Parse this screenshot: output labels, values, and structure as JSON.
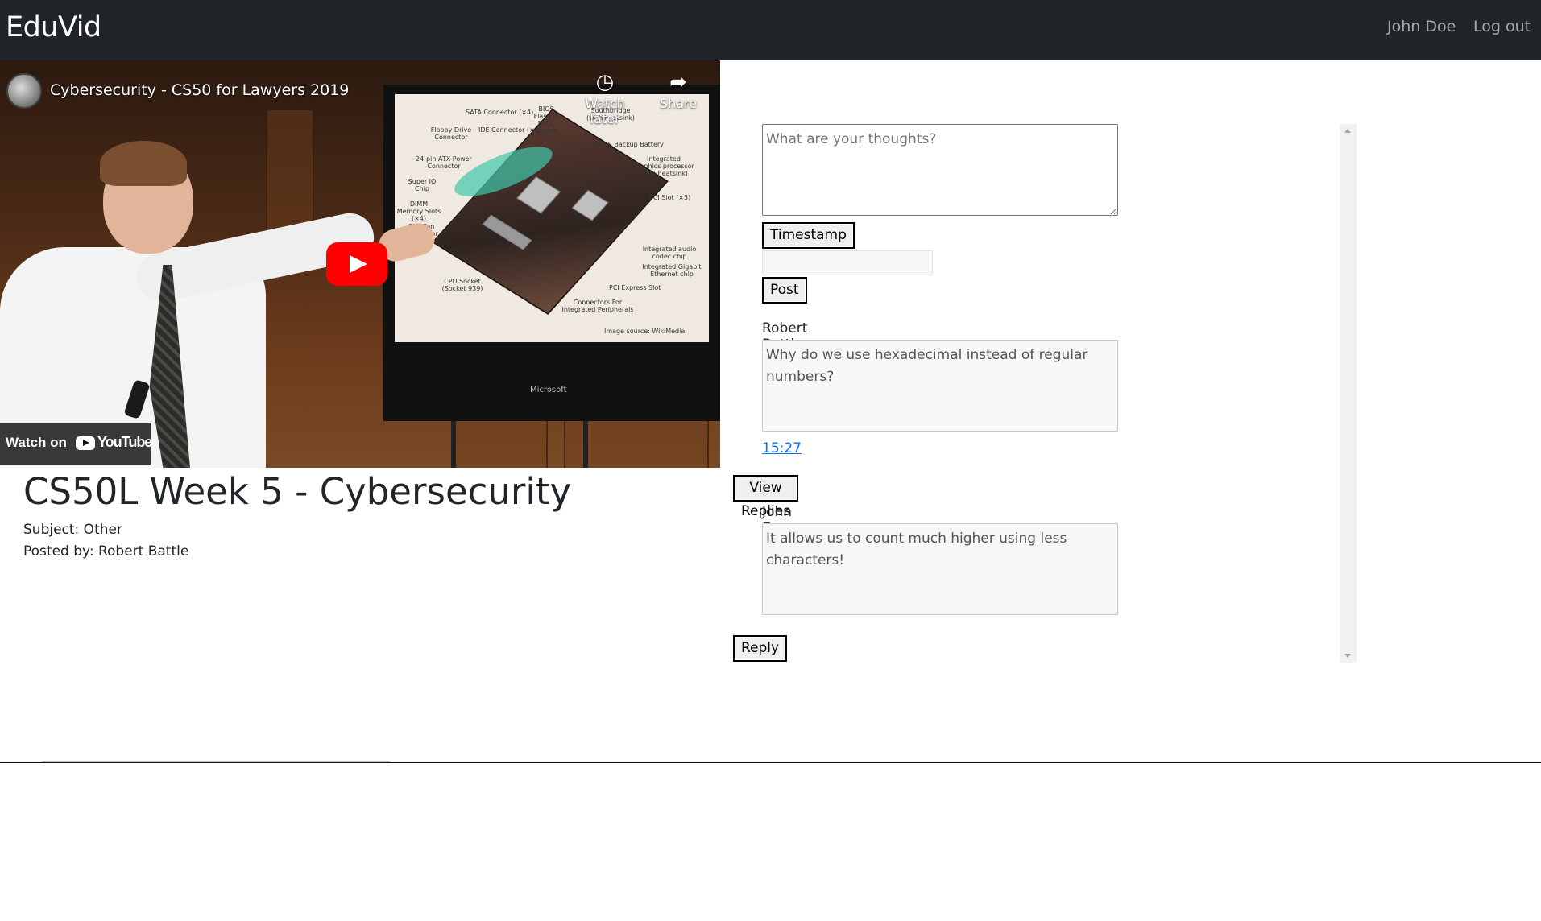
{
  "navbar": {
    "brand": "EduVid",
    "user": "John Doe",
    "logout": "Log out"
  },
  "video": {
    "title": "Cybersecurity - CS50 for Lawyers 2019",
    "watch_later": "Watch later",
    "share": "Share",
    "watch_on": "Watch on",
    "youtube": "YouTube",
    "slide_labels": [
      "SATA Connector (×4)",
      "BIOS Flash in PLCC Socket",
      "Southbridge (with heatsink)",
      "IDE Connector (×2)",
      "Floppy Drive Connector",
      "CMOS Backup Battery",
      "24-pin ATX Power Connector",
      "Integrated graphics processor (with heatsink)",
      "Super IO Chip",
      "DIMM Memory Slots (×4)",
      "PCI Slot (×3)",
      "CPU Fan Connector",
      "Integrated audio codec chip",
      "Integrated Gigabit Ethernet chip",
      "CPU Socket (Socket 939)",
      "PCI Express Slot",
      "Connectors For Integrated Peripherals",
      "Image source: WikiMedia"
    ],
    "microsoft": "Microsoft"
  },
  "page": {
    "title": "CS50L Week 5 - Cybersecurity",
    "subject": "Subject: Other",
    "posted_by": "Posted by: Robert Battle"
  },
  "comments": {
    "placeholder": "What are your thoughts?",
    "timestamp_button": "Timestamp",
    "post_button": "Post",
    "items": [
      {
        "author": "Robert Battle",
        "text": "Why do we use hexadecimal instead of regular numbers?",
        "timestamp": "15:27",
        "view_replies": "View Replies"
      },
      {
        "author": "John Doe",
        "text": "It allows us to count much higher using less characters!",
        "reply": "Reply"
      }
    ]
  }
}
